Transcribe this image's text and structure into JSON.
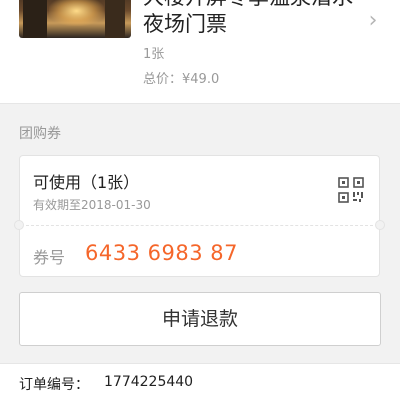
{
  "deal": {
    "title": "大楼开屏冬季温泉潜水夜场门票",
    "quantity": "1张",
    "total": "总价：¥49.0",
    "chevron_icon": "chevron-right-icon"
  },
  "voucher_section": {
    "label": "团购券",
    "status": "可使用（1张）",
    "expiry": "有效期至2018-01-30",
    "qr_icon": "qr-code-icon",
    "code_label": "券号",
    "code": "6433 6983 87",
    "code_color": "#f5662a"
  },
  "refund_button": {
    "label": "申请退款"
  },
  "order": {
    "label": "订单编号：",
    "number": "1774225440"
  }
}
